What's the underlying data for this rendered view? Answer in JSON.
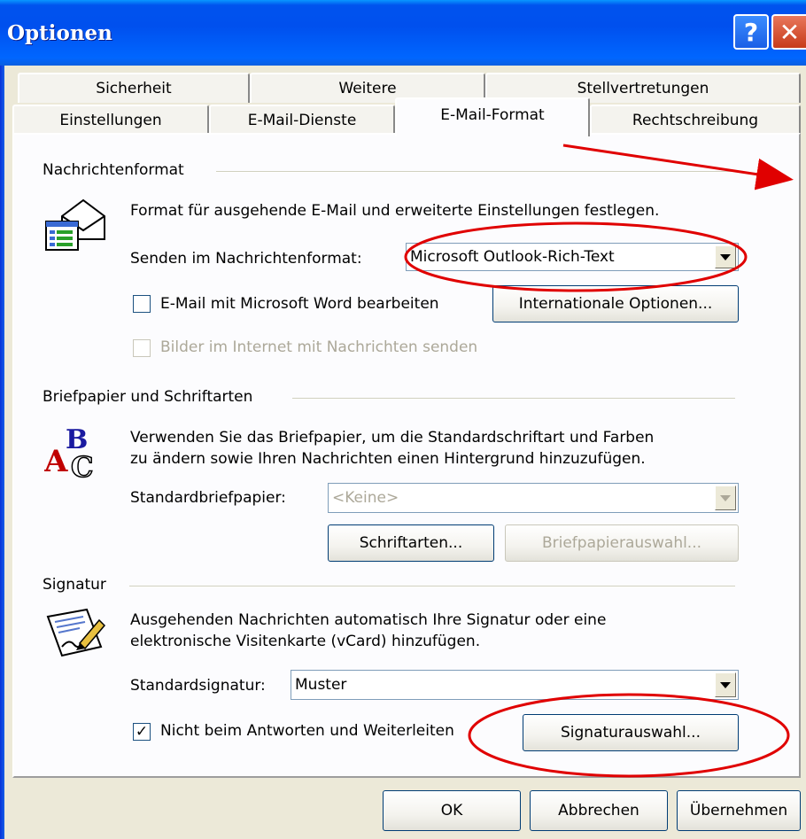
{
  "window": {
    "title": "Optionen",
    "help_glyph": "?",
    "close_glyph": "✕"
  },
  "tabs_back": [
    "Sicherheit",
    "Weitere",
    "Stellvertretungen"
  ],
  "tabs_front": [
    "Einstellungen",
    "E-Mail-Dienste",
    "E-Mail-Format",
    "Rechtschreibung"
  ],
  "active_tab": "E-Mail-Format",
  "message_format": {
    "group_title": "Nachrichtenformat",
    "description": "Format für ausgehende E-Mail und erweiterte Einstellungen festlegen.",
    "send_label": "Senden im Nachrichtenformat:",
    "send_value": "Microsoft Outlook-Rich-Text",
    "word_checkbox_label": "E-Mail mit Microsoft Word bearbeiten",
    "word_checkbox_checked": false,
    "intl_button": "Internationale Optionen...",
    "pictures_checkbox_label": "Bilder im Internet mit Nachrichten senden",
    "pictures_checkbox_checked": false
  },
  "stationery": {
    "group_title": "Briefpapier und Schriftarten",
    "description_line1": "Verwenden Sie das Briefpapier, um die Standardschriftart und Farben",
    "description_line2": "zu ändern sowie Ihren Nachrichten einen Hintergrund hinzuzufügen.",
    "default_label": "Standardbriefpapier:",
    "default_value": "<Keine>",
    "fonts_button": "Schriftarten...",
    "picker_button": "Briefpapierauswahl..."
  },
  "signature": {
    "group_title": "Signatur",
    "description_line1": "Ausgehenden Nachrichten automatisch Ihre Signatur oder eine",
    "description_line2": "elektronische Visitenkarte (vCard) hinzufügen.",
    "default_label": "Standardsignatur:",
    "default_value": "Muster",
    "no_reply_label": "Nicht beim Antworten und Weiterleiten",
    "no_reply_checked": true,
    "check_glyph": "✓",
    "picker_button": "Signaturauswahl..."
  },
  "footer": {
    "ok": "OK",
    "cancel": "Abbrechen",
    "apply": "Übernehmen"
  },
  "colors": {
    "annotation": "#e00000",
    "titlebar": "#0050ee",
    "dialog_bg": "#ece9d8"
  }
}
